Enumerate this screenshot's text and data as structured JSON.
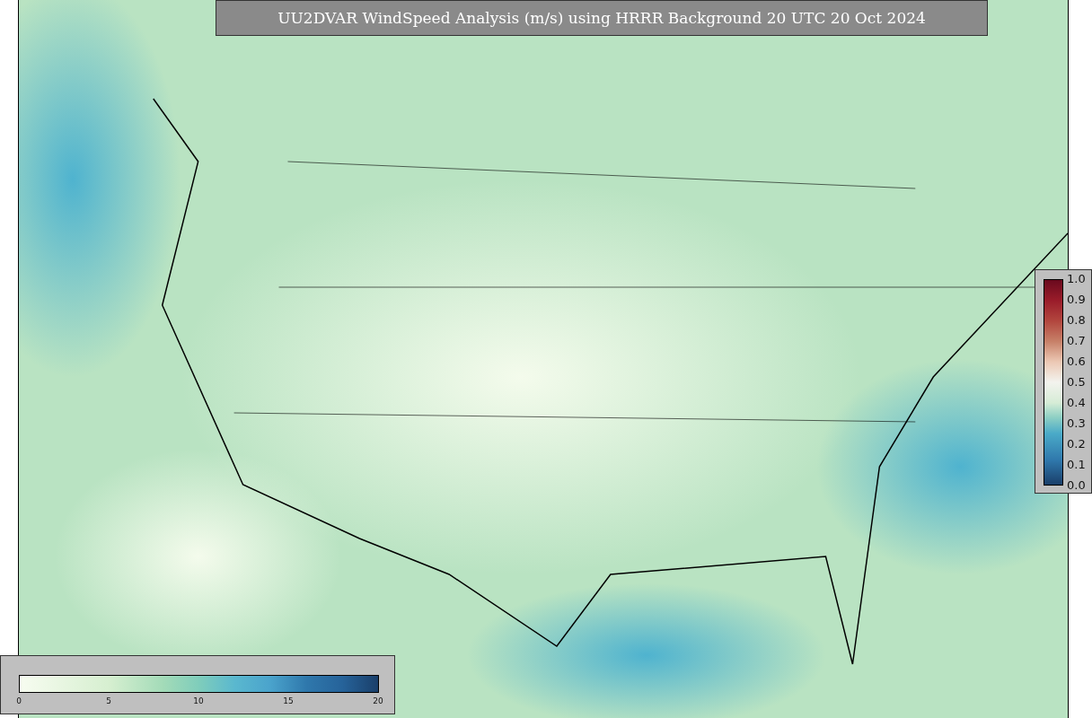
{
  "title": "UU2DVAR WindSpeed Analysis (m/s) using HRRR Background 20 UTC 20 Oct 2024",
  "right_colorbar": {
    "ticks": [
      "1.0",
      "0.9",
      "0.8",
      "0.7",
      "0.6",
      "0.5",
      "0.4",
      "0.3",
      "0.2",
      "0.1",
      "0.0"
    ]
  },
  "bottom_colorbar": {
    "ticks": [
      "0",
      "5",
      "10",
      "15",
      "20"
    ]
  }
}
